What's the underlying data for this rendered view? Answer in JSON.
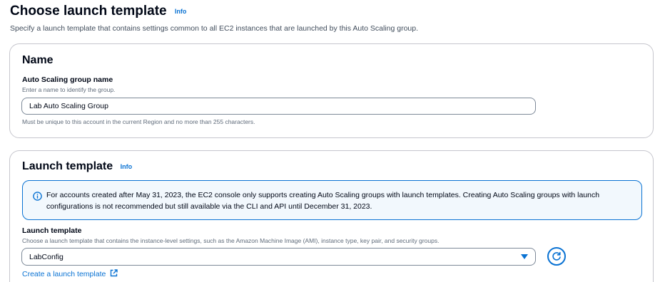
{
  "header": {
    "title": "Choose launch template",
    "info_label": "Info",
    "description": "Specify a launch template that contains settings common to all EC2 instances that are launched by this Auto Scaling group."
  },
  "name_section": {
    "title": "Name",
    "field_label": "Auto Scaling group name",
    "field_description": "Enter a name to identify the group.",
    "field_value": "Lab Auto Scaling Group",
    "constraint": "Must be unique to this account in the current Region and no more than 255 characters."
  },
  "launch_template_section": {
    "title": "Launch template",
    "info_label": "Info",
    "alert_icon": "info-circle-icon",
    "alert_text": "For accounts created after May 31, 2023, the EC2 console only supports creating Auto Scaling groups with launch templates. Creating Auto Scaling groups with launch configurations is not recommended but still available via the CLI and API until December 31, 2023.",
    "field_label": "Launch template",
    "field_description": "Choose a launch template that contains the instance-level settings, such as the Amazon Machine Image (AMI), instance type, key pair, and security groups.",
    "selected_value": "LabConfig",
    "refresh_icon": "refresh-icon",
    "create_link": "Create a launch template",
    "external_icon": "external-link-icon"
  },
  "colors": {
    "link": "#0972d3",
    "alert_background": "#f2f8fd",
    "border": "#c6c6cd",
    "text": "#000716"
  }
}
